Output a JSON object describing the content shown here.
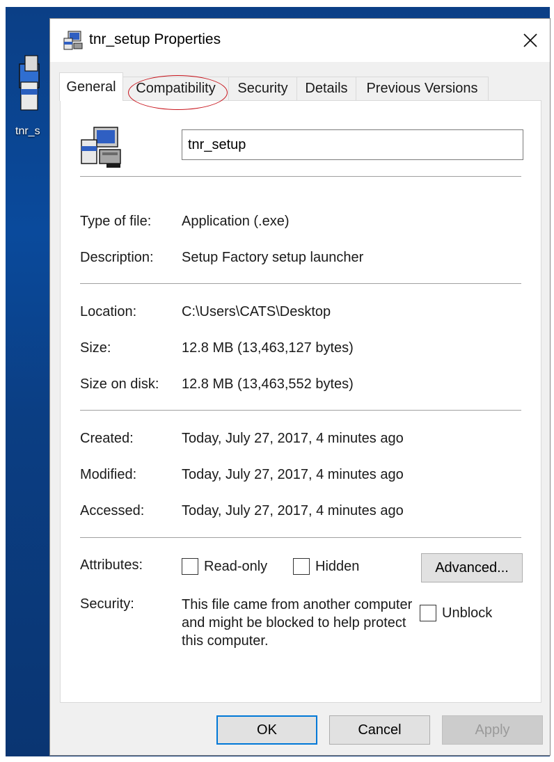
{
  "desktop": {
    "icon_label": "tnr_s"
  },
  "window": {
    "title": "tnr_setup Properties",
    "close_glyph": "✕"
  },
  "tabs": [
    {
      "label": "General",
      "active": true
    },
    {
      "label": "Compatibility",
      "active": false,
      "highlighted": true
    },
    {
      "label": "Security",
      "active": false
    },
    {
      "label": "Details",
      "active": false
    },
    {
      "label": "Previous Versions",
      "active": false
    }
  ],
  "general": {
    "file_name": "tnr_setup",
    "type_label": "Type of file:",
    "type_value": "Application (.exe)",
    "description_label": "Description:",
    "description_value": "Setup Factory setup launcher",
    "location_label": "Location:",
    "location_value": "C:\\Users\\CATS\\Desktop",
    "size_label": "Size:",
    "size_value": "12.8 MB (13,463,127 bytes)",
    "size_on_disk_label": "Size on disk:",
    "size_on_disk_value": "12.8 MB (13,463,552 bytes)",
    "created_label": "Created:",
    "created_value": "Today, July 27, 2017, 4 minutes ago",
    "modified_label": "Modified:",
    "modified_value": "Today, July 27, 2017, 4 minutes ago",
    "accessed_label": "Accessed:",
    "accessed_value": "Today, July 27, 2017, 4 minutes ago",
    "attributes_label": "Attributes:",
    "readonly_label": "Read-only",
    "readonly_checked": false,
    "hidden_label": "Hidden",
    "hidden_checked": false,
    "advanced_label": "Advanced...",
    "security_label": "Security:",
    "security_text": "This file came from another computer and might be blocked to help protect this computer.",
    "unblock_label": "Unblock",
    "unblock_checked": false
  },
  "buttons": {
    "ok": "OK",
    "cancel": "Cancel",
    "apply": "Apply"
  },
  "colors": {
    "highlight_circle": "#c8141c",
    "default_button_border": "#0078d7",
    "desktop_background": "#0b3f86"
  },
  "icons": {
    "title_icon": "setup-installer-icon",
    "file_icon": "setup-installer-icon",
    "close_icon": "close-icon"
  }
}
